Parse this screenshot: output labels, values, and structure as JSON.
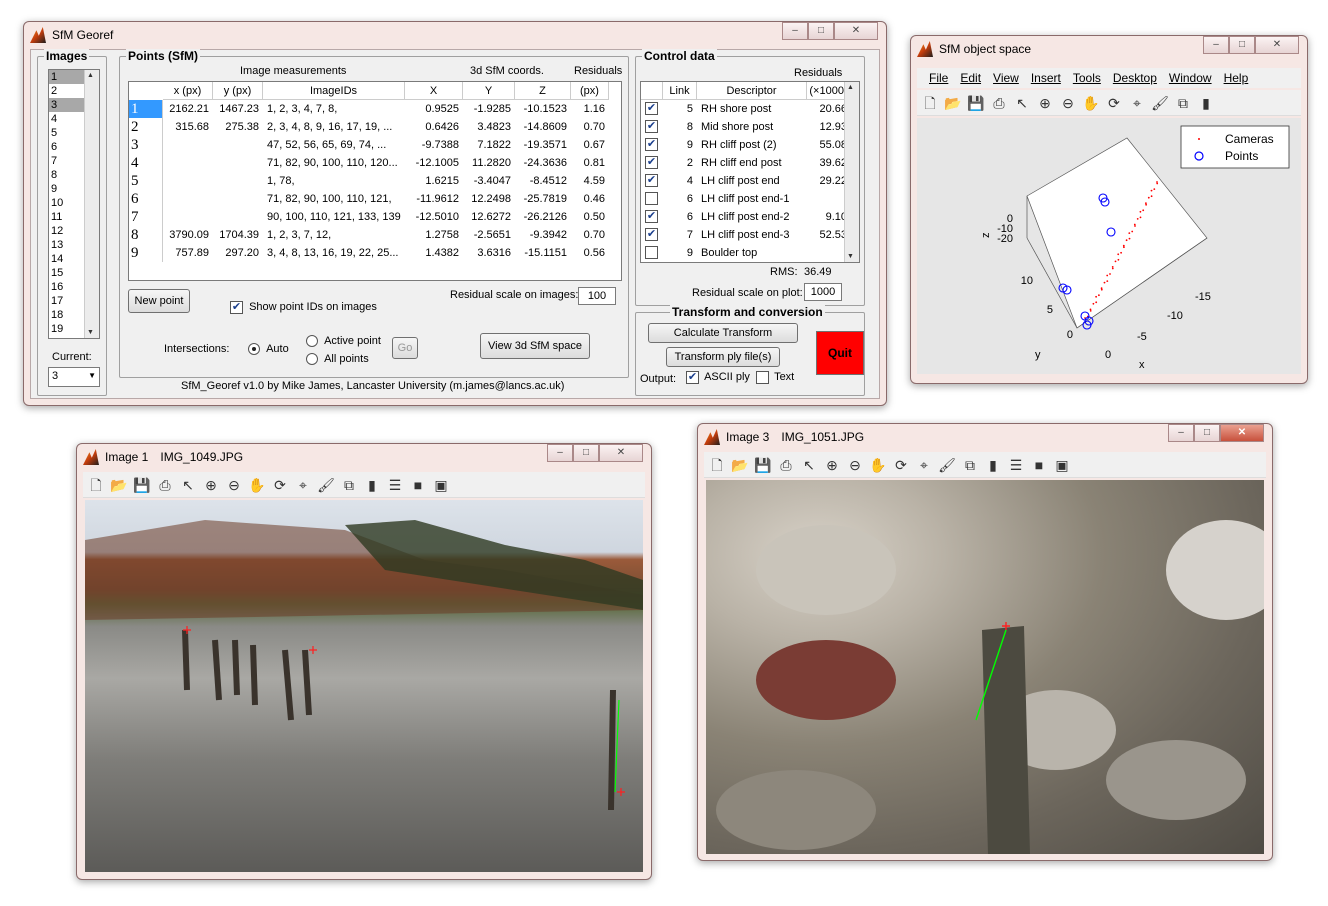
{
  "georef": {
    "title": "SfM Georef",
    "images_panel": {
      "title": "Images",
      "items": [
        "1",
        "2",
        "3",
        "4",
        "5",
        "6",
        "7",
        "8",
        "9",
        "10",
        "11",
        "12",
        "13",
        "14",
        "15",
        "16",
        "17",
        "18",
        "19"
      ],
      "selected": [
        "1",
        "3"
      ],
      "current_label": "Current:",
      "current_value": "3"
    },
    "points_panel": {
      "title": "Points (SfM)",
      "group_image": "Image measurements",
      "group_sfm": "3d SfM coords.",
      "group_res": "Residuals",
      "headers": [
        "x (px)",
        "y (px)",
        "ImageIDs",
        "X",
        "Y",
        "Z",
        "(px)"
      ],
      "rows": [
        {
          "id": "1",
          "x": "2162.21",
          "y": "1467.23",
          "ids": "1, 2, 3, 4, 7, 8,",
          "X": "0.9525",
          "Y": "-1.9285",
          "Z": "-10.1523",
          "r": "1.16"
        },
        {
          "id": "2",
          "x": "315.68",
          "y": "275.38",
          "ids": "2,  3,  4,  8,  9, 16, 17, 19, ...",
          "X": "0.6426",
          "Y": "3.4823",
          "Z": "-14.8609",
          "r": "0.70"
        },
        {
          "id": "3",
          "x": "",
          "y": "",
          "ids": "47,  52,  56,  65,  69,  74,  ...",
          "X": "-9.7388",
          "Y": "7.1822",
          "Z": "-19.3571",
          "r": "0.67"
        },
        {
          "id": "4",
          "x": "",
          "y": "",
          "ids": "71,  82,  90, 100, 110, 120...",
          "X": "-12.1005",
          "Y": "11.2820",
          "Z": "-24.3636",
          "r": "0.81"
        },
        {
          "id": "5",
          "x": "",
          "y": "",
          "ids": "1, 78,",
          "X": "1.6215",
          "Y": "-3.4047",
          "Z": "-8.4512",
          "r": "4.59"
        },
        {
          "id": "6",
          "x": "",
          "y": "",
          "ids": "71,  82,  90, 100, 110, 121,",
          "X": "-11.9612",
          "Y": "12.2498",
          "Z": "-25.7819",
          "r": "0.46"
        },
        {
          "id": "7",
          "x": "",
          "y": "",
          "ids": "90, 100, 110, 121, 133, 139,",
          "X": "-12.5010",
          "Y": "12.6272",
          "Z": "-26.2126",
          "r": "0.50"
        },
        {
          "id": "8",
          "x": "3790.09",
          "y": "1704.39",
          "ids": "1,  2,  3,  7, 12,",
          "X": "1.2758",
          "Y": "-2.5651",
          "Z": "-9.3942",
          "r": "0.70"
        },
        {
          "id": "9",
          "x": "757.89",
          "y": "297.20",
          "ids": "3,  4,  8, 13, 16, 19, 22, 25...",
          "X": "1.4382",
          "Y": "3.6316",
          "Z": "-15.1151",
          "r": "0.56"
        }
      ],
      "residual_scale_label": "Residual scale on images:",
      "residual_scale_value": "100",
      "new_point": "New point",
      "show_ids": "Show point IDs on images",
      "intersections_label": "Intersections:",
      "auto": "Auto",
      "active_point": "Active point",
      "all_points": "All points",
      "go": "Go",
      "view3d": "View 3d SfM space"
    },
    "control_panel": {
      "title": "Control data",
      "residuals_label": "Residuals",
      "headers": [
        "Link",
        "Descriptor",
        "(×1000)"
      ],
      "rows": [
        {
          "checked": true,
          "link": "5",
          "desc": "RH shore post",
          "res": "20.66"
        },
        {
          "checked": true,
          "link": "8",
          "desc": "Mid shore post",
          "res": "12.93"
        },
        {
          "checked": true,
          "link": "9",
          "desc": "RH cliff post (2)",
          "res": "55.08"
        },
        {
          "checked": true,
          "link": "2",
          "desc": "RH cliff end post",
          "res": "39.62"
        },
        {
          "checked": true,
          "link": "4",
          "desc": "LH cliff post end",
          "res": "29.22"
        },
        {
          "checked": false,
          "link": "6",
          "desc": "LH cliff post end-1",
          "res": ""
        },
        {
          "checked": true,
          "link": "6",
          "desc": "LH cliff post end-2",
          "res": "9.10"
        },
        {
          "checked": true,
          "link": "7",
          "desc": "LH cliff post end-3",
          "res": "52.53"
        },
        {
          "checked": false,
          "link": "9",
          "desc": "Boulder top",
          "res": ""
        }
      ],
      "rms_label": "RMS:",
      "rms_value": "36.49",
      "res_plot_label": "Residual scale on plot:",
      "res_plot_value": "1000"
    },
    "transform_panel": {
      "title": "Transform and conversion",
      "calc": "Calculate Transform",
      "ply": "Transform ply file(s)",
      "output_label": "Output:",
      "ascii": "ASCII ply",
      "text": "Text",
      "quit": "Quit",
      "quit_color": "#ff0000"
    },
    "footer": "SfM_Georef v1.0 by Mike James, Lancaster University (m.james@lancs.ac.uk)"
  },
  "objspace": {
    "title": "SfM object space",
    "menu": [
      "File",
      "Edit",
      "View",
      "Insert",
      "Tools",
      "Desktop",
      "Window",
      "Help"
    ],
    "legend": [
      "Cameras",
      "Points"
    ],
    "z_label": "z",
    "y_label": "y",
    "x_label": "x",
    "z_ticks": [
      "0",
      "-10",
      "-20"
    ],
    "y_ticks": [
      "10",
      "5",
      "0"
    ],
    "x_ticks": [
      "-15",
      "-10",
      "-5",
      "0"
    ],
    "point_color": "#0000ff",
    "camera_color": "#ff0000"
  },
  "img1": {
    "title": "Image 1",
    "file": "IMG_1049.JPG"
  },
  "img3": {
    "title": "Image 3",
    "file": "IMG_1051.JPG"
  },
  "win_buttons": {
    "min": "–",
    "max": "□",
    "close": "✕"
  }
}
